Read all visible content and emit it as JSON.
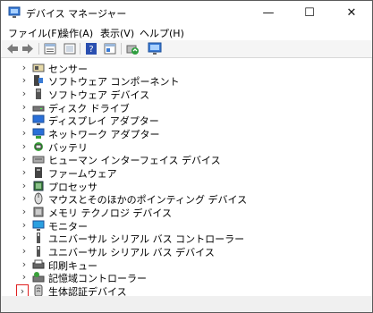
{
  "window": {
    "title": "デバイス マネージャー",
    "min_symbol": "—",
    "max_symbol": "☐",
    "close_symbol": "✕"
  },
  "menu": [
    "ファイル(F)",
    "操作(A)",
    "表示(V)",
    "ヘルプ(H)"
  ],
  "toolbar": {
    "buttons": [
      "back-icon",
      "forward-icon",
      "properties-icon",
      "view-icon",
      "help-icon",
      "device-info-icon",
      "update-driver-icon",
      "monitor-icon"
    ]
  },
  "tree": {
    "chevron": "›",
    "items": [
      {
        "label": "センサー",
        "icon": "sensor-icon"
      },
      {
        "label": "ソフトウェア コンポーネント",
        "icon": "software-component-icon"
      },
      {
        "label": "ソフトウェア デバイス",
        "icon": "software-device-icon"
      },
      {
        "label": "ディスク ドライブ",
        "icon": "disk-drive-icon"
      },
      {
        "label": "ディスプレイ アダプター",
        "icon": "display-adapter-icon"
      },
      {
        "label": "ネットワーク アダプター",
        "icon": "network-adapter-icon"
      },
      {
        "label": "バッテリ",
        "icon": "battery-icon"
      },
      {
        "label": "ヒューマン インターフェイス デバイス",
        "icon": "hid-icon"
      },
      {
        "label": "ファームウェア",
        "icon": "firmware-icon"
      },
      {
        "label": "プロセッサ",
        "icon": "processor-icon"
      },
      {
        "label": "マウスとそのほかのポインティング デバイス",
        "icon": "mouse-icon"
      },
      {
        "label": "メモリ テクノロジ デバイス",
        "icon": "memory-icon"
      },
      {
        "label": "モニター",
        "icon": "monitor-icon"
      },
      {
        "label": "ユニバーサル シリアル バス コントローラー",
        "icon": "usb-icon"
      },
      {
        "label": "ユニバーサル シリアル バス デバイス",
        "icon": "usb-device-icon"
      },
      {
        "label": "印刷キュー",
        "icon": "print-queue-icon"
      },
      {
        "label": "記憶域コントローラー",
        "icon": "storage-controller-icon"
      },
      {
        "label": "生体認証デバイス",
        "icon": "biometric-icon"
      }
    ]
  },
  "colors": {
    "accent": "#2a6fd8",
    "focus_outline": "#e02020"
  }
}
